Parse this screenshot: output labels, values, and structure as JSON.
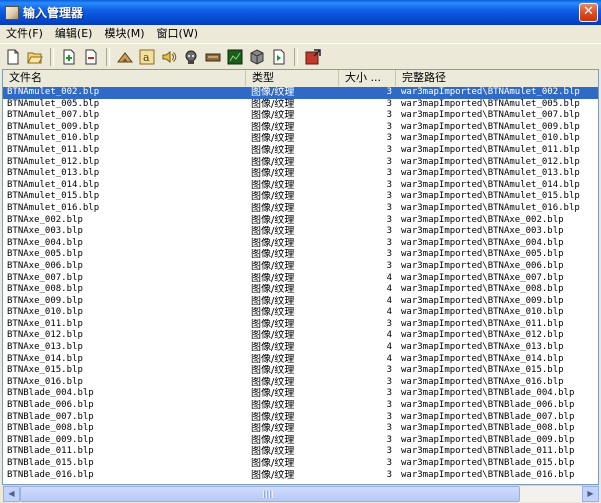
{
  "window": {
    "title": "输入管理器",
    "close_label": "✕"
  },
  "menu": [
    "文件(F)",
    "编辑(E)",
    "模块(M)",
    "窗口(W)"
  ],
  "toolbar": [
    "new-file-icon",
    "open-folder-icon",
    "import-file-icon",
    "export-file-icon",
    "model-icon",
    "font-icon",
    "sound-icon",
    "ai-icon",
    "keyboard-icon",
    "terrain-icon",
    "cube-icon",
    "properties-icon",
    "exit-icon"
  ],
  "columns": {
    "name": "文件名",
    "type": "类型",
    "size": "大小 ...",
    "path": "完整路径"
  },
  "rows": [
    {
      "name": "BTNAmulet_002.blp",
      "type": "图像/纹理",
      "size": "3",
      "path": "war3mapImported\\BTNAmulet_002.blp"
    },
    {
      "name": "BTNAmulet_005.blp",
      "type": "图像/纹理",
      "size": "3",
      "path": "war3mapImported\\BTNAmulet_005.blp"
    },
    {
      "name": "BTNAmulet_007.blp",
      "type": "图像/纹理",
      "size": "3",
      "path": "war3mapImported\\BTNAmulet_007.blp"
    },
    {
      "name": "BTNAmulet_009.blp",
      "type": "图像/纹理",
      "size": "3",
      "path": "war3mapImported\\BTNAmulet_009.blp"
    },
    {
      "name": "BTNAmulet_010.blp",
      "type": "图像/纹理",
      "size": "3",
      "path": "war3mapImported\\BTNAmulet_010.blp"
    },
    {
      "name": "BTNAmulet_011.blp",
      "type": "图像/纹理",
      "size": "3",
      "path": "war3mapImported\\BTNAmulet_011.blp"
    },
    {
      "name": "BTNAmulet_012.blp",
      "type": "图像/纹理",
      "size": "3",
      "path": "war3mapImported\\BTNAmulet_012.blp"
    },
    {
      "name": "BTNAmulet_013.blp",
      "type": "图像/纹理",
      "size": "3",
      "path": "war3mapImported\\BTNAmulet_013.blp"
    },
    {
      "name": "BTNAmulet_014.blp",
      "type": "图像/纹理",
      "size": "3",
      "path": "war3mapImported\\BTNAmulet_014.blp"
    },
    {
      "name": "BTNAmulet_015.blp",
      "type": "图像/纹理",
      "size": "3",
      "path": "war3mapImported\\BTNAmulet_015.blp"
    },
    {
      "name": "BTNAmulet_016.blp",
      "type": "图像/纹理",
      "size": "3",
      "path": "war3mapImported\\BTNAmulet_016.blp"
    },
    {
      "name": "BTNAxe_002.blp",
      "type": "图像/纹理",
      "size": "3",
      "path": "war3mapImported\\BTNAxe_002.blp"
    },
    {
      "name": "BTNAxe_003.blp",
      "type": "图像/纹理",
      "size": "3",
      "path": "war3mapImported\\BTNAxe_003.blp"
    },
    {
      "name": "BTNAxe_004.blp",
      "type": "图像/纹理",
      "size": "3",
      "path": "war3mapImported\\BTNAxe_004.blp"
    },
    {
      "name": "BTNAxe_005.blp",
      "type": "图像/纹理",
      "size": "3",
      "path": "war3mapImported\\BTNAxe_005.blp"
    },
    {
      "name": "BTNAxe_006.blp",
      "type": "图像/纹理",
      "size": "3",
      "path": "war3mapImported\\BTNAxe_006.blp"
    },
    {
      "name": "BTNAxe_007.blp",
      "type": "图像/纹理",
      "size": "4",
      "path": "war3mapImported\\BTNAxe_007.blp"
    },
    {
      "name": "BTNAxe_008.blp",
      "type": "图像/纹理",
      "size": "4",
      "path": "war3mapImported\\BTNAxe_008.blp"
    },
    {
      "name": "BTNAxe_009.blp",
      "type": "图像/纹理",
      "size": "4",
      "path": "war3mapImported\\BTNAxe_009.blp"
    },
    {
      "name": "BTNAxe_010.blp",
      "type": "图像/纹理",
      "size": "4",
      "path": "war3mapImported\\BTNAxe_010.blp"
    },
    {
      "name": "BTNAxe_011.blp",
      "type": "图像/纹理",
      "size": "3",
      "path": "war3mapImported\\BTNAxe_011.blp"
    },
    {
      "name": "BTNAxe_012.blp",
      "type": "图像/纹理",
      "size": "4",
      "path": "war3mapImported\\BTNAxe_012.blp"
    },
    {
      "name": "BTNAxe_013.blp",
      "type": "图像/纹理",
      "size": "4",
      "path": "war3mapImported\\BTNAxe_013.blp"
    },
    {
      "name": "BTNAxe_014.blp",
      "type": "图像/纹理",
      "size": "4",
      "path": "war3mapImported\\BTNAxe_014.blp"
    },
    {
      "name": "BTNAxe_015.blp",
      "type": "图像/纹理",
      "size": "3",
      "path": "war3mapImported\\BTNAxe_015.blp"
    },
    {
      "name": "BTNAxe_016.blp",
      "type": "图像/纹理",
      "size": "3",
      "path": "war3mapImported\\BTNAxe_016.blp"
    },
    {
      "name": "BTNBlade_004.blp",
      "type": "图像/纹理",
      "size": "3",
      "path": "war3mapImported\\BTNBlade_004.blp"
    },
    {
      "name": "BTNBlade_006.blp",
      "type": "图像/纹理",
      "size": "3",
      "path": "war3mapImported\\BTNBlade_006.blp"
    },
    {
      "name": "BTNBlade_007.blp",
      "type": "图像/纹理",
      "size": "3",
      "path": "war3mapImported\\BTNBlade_007.blp"
    },
    {
      "name": "BTNBlade_008.blp",
      "type": "图像/纹理",
      "size": "3",
      "path": "war3mapImported\\BTNBlade_008.blp"
    },
    {
      "name": "BTNBlade_009.blp",
      "type": "图像/纹理",
      "size": "3",
      "path": "war3mapImported\\BTNBlade_009.blp"
    },
    {
      "name": "BTNBlade_011.blp",
      "type": "图像/纹理",
      "size": "3",
      "path": "war3mapImported\\BTNBlade_011.blp"
    },
    {
      "name": "BTNBlade_015.blp",
      "type": "图像/纹理",
      "size": "3",
      "path": "war3mapImported\\BTNBlade_015.blp"
    },
    {
      "name": "BTNBlade_016.blp",
      "type": "图像/纹理",
      "size": "3",
      "path": "war3mapImported\\BTNBlade_016.blp"
    }
  ],
  "selected_row": 0
}
